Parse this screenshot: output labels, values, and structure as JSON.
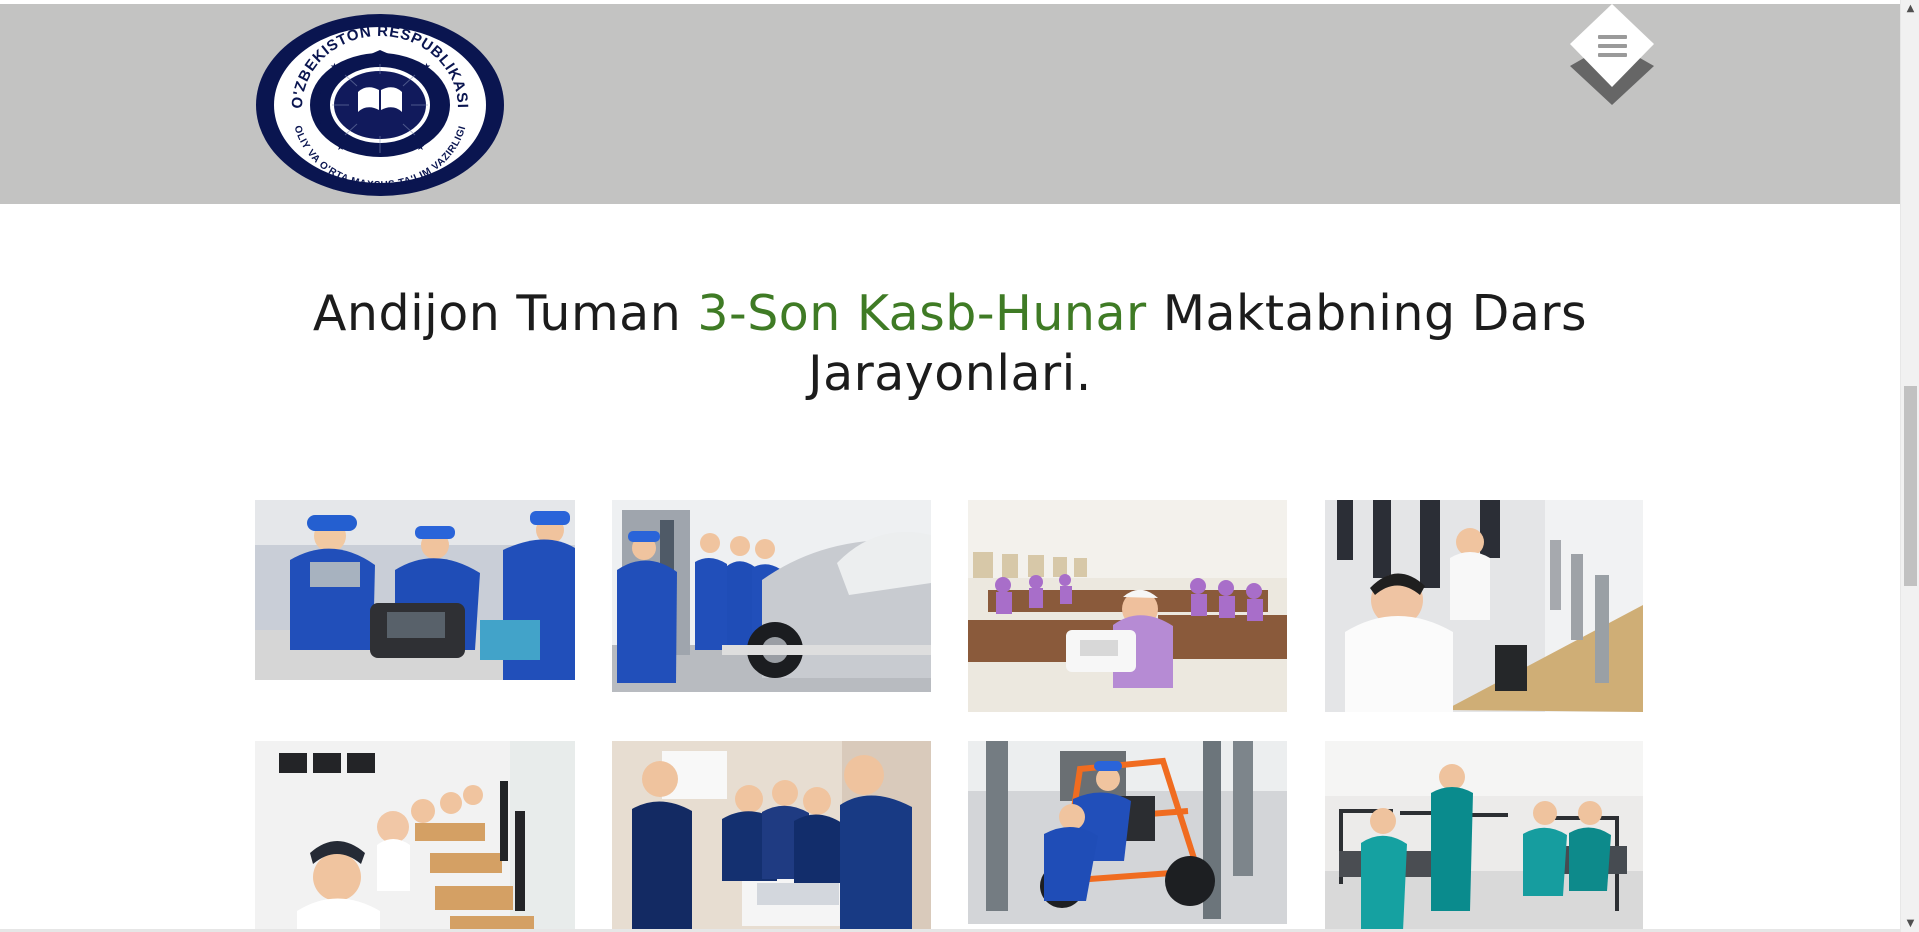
{
  "header": {
    "logo": {
      "ring_text_top": "O'ZBEKISTON RESPUBLIKASI",
      "ring_text_bottom": "OLIY VA O'RTA MAXSUS TA'LIM VAZIRLIGI",
      "icon": "book-icon",
      "cap_icon": "graduation-cap-icon"
    },
    "menu": {
      "icon": "hamburger-menu-icon"
    }
  },
  "main": {
    "headline": {
      "before": "Andijon Tuman ",
      "accent": "3-Son Kasb-Hunar",
      "after": " Maktabning Dars Jarayonlari."
    }
  },
  "gallery": {
    "items": [
      {
        "name": "auto-mechanics-students-engine"
      },
      {
        "name": "students-inspecting-car"
      },
      {
        "name": "sewing-class"
      },
      {
        "name": "computer-lab-boys"
      },
      {
        "name": "computer-lab-girls"
      },
      {
        "name": "electronics-workshop"
      },
      {
        "name": "go-kart-workshop"
      },
      {
        "name": "lab-students-teal-coats"
      }
    ]
  },
  "colors": {
    "header_bg": "#c3c3c2",
    "accent": "#3f7b25",
    "text": "#1c1c1c",
    "logo_navy": "#0a1550"
  }
}
